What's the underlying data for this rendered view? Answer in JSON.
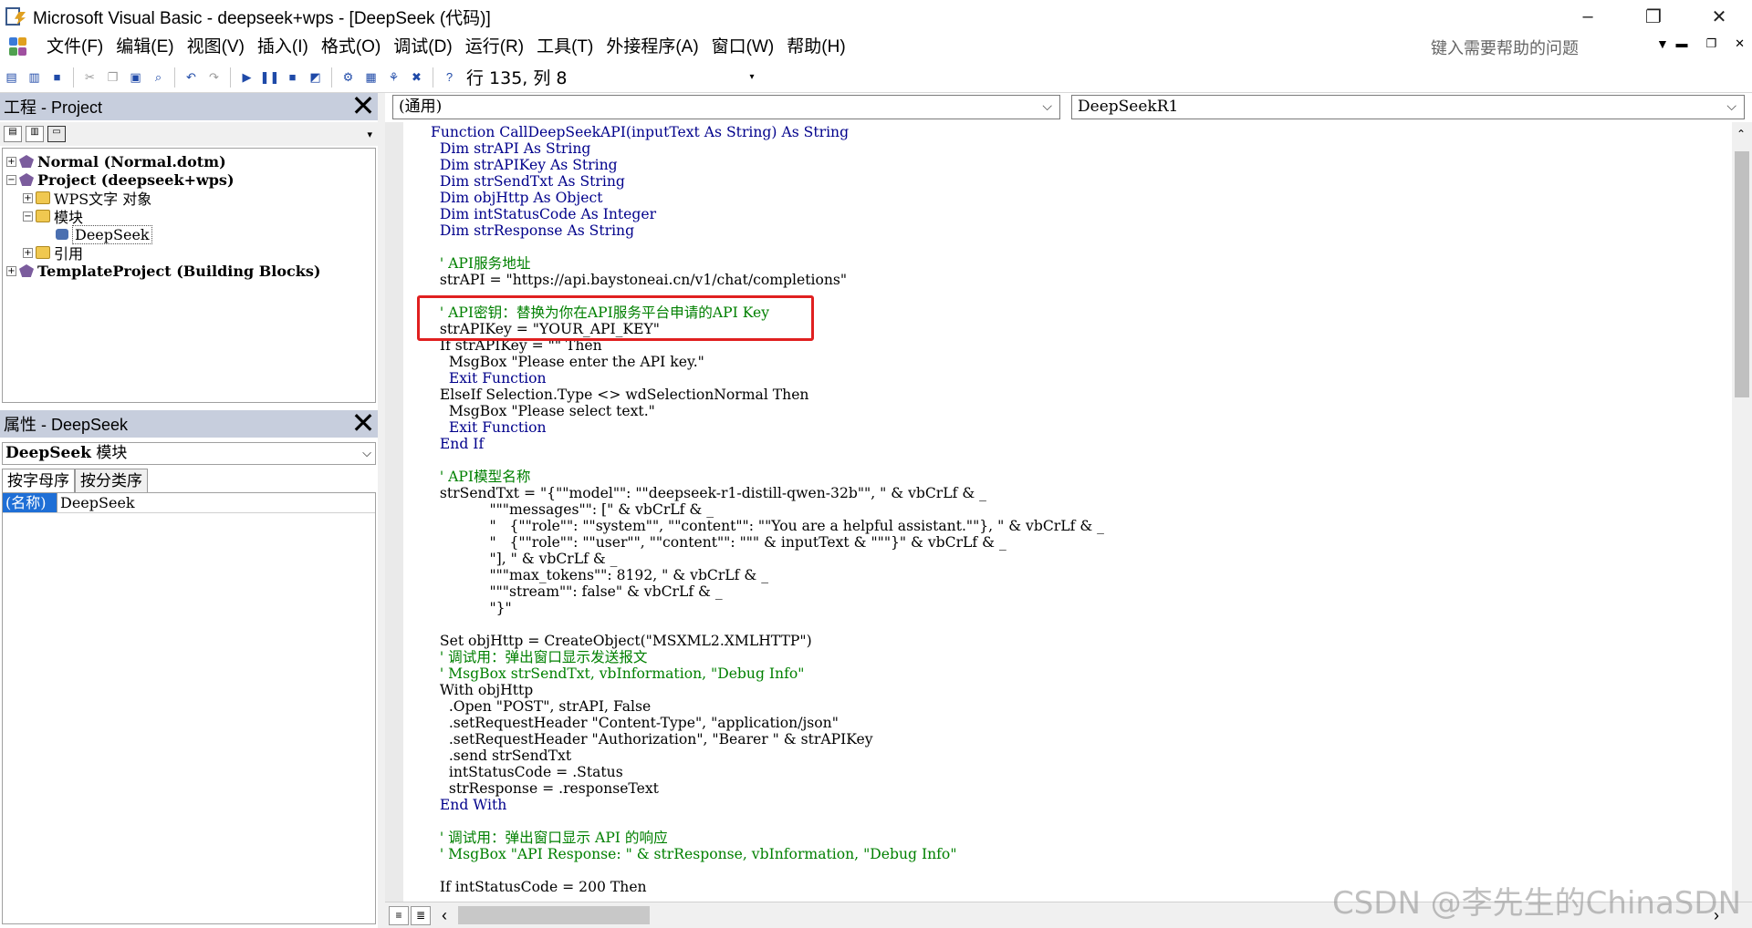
{
  "window": {
    "title": "Microsoft Visual Basic - deepseek+wps - [DeepSeek (代码)]",
    "minimize": "–",
    "restore": "❐",
    "close": "✕"
  },
  "menu": {
    "items": [
      "文件(F)",
      "编辑(E)",
      "视图(V)",
      "插入(I)",
      "格式(O)",
      "调试(D)",
      "运行(R)",
      "工具(T)",
      "外接程序(A)",
      "窗口(W)",
      "帮助(H)"
    ],
    "help_placeholder": "键入需要帮助的问题"
  },
  "toolbar": {
    "position_text": "行 135, 列 8"
  },
  "project_panel": {
    "title": "工程 - Project",
    "tree": [
      {
        "label": "Normal (Normal.dotm)",
        "bold": true
      },
      {
        "label": "Project (deepseek+wps)",
        "bold": true
      },
      {
        "label": "WPS文字 对象"
      },
      {
        "label": "模块"
      },
      {
        "label": "DeepSeek"
      },
      {
        "label": "引用"
      },
      {
        "label": "TemplateProject (Building Blocks)",
        "bold": true
      }
    ]
  },
  "properties_panel": {
    "title": "属性 - DeepSeek",
    "object_combo_bold": "DeepSeek",
    "object_combo_rest": " 模块",
    "tab_alpha": "按字母序",
    "tab_category": "按分类序",
    "rows": [
      {
        "key": "(名称)",
        "value": "DeepSeek"
      }
    ]
  },
  "code_window": {
    "object_combo": "(通用)",
    "proc_combo": "DeepSeekR1",
    "lines": [
      {
        "text": "Function CallDeepSeekAPI(inputText As String) As String",
        "type": "kw"
      },
      {
        "text": "  Dim strAPI As String",
        "type": "kw"
      },
      {
        "text": "  Dim strAPIKey As String",
        "type": "kw"
      },
      {
        "text": "  Dim strSendTxt As String",
        "type": "kw"
      },
      {
        "text": "  Dim objHttp As Object",
        "type": "kw"
      },
      {
        "text": "  Dim intStatusCode As Integer",
        "type": "kw"
      },
      {
        "text": "  Dim strResponse As String",
        "type": "kw"
      },
      {
        "text": "",
        "type": "n"
      },
      {
        "text": "  ' API服务地址",
        "type": "cm"
      },
      {
        "text": "  strAPI = \"https://api.baystoneai.cn/v1/chat/completions\"",
        "type": "n"
      },
      {
        "text": "",
        "type": "n"
      },
      {
        "text": "  ' API密钥：替换为你在API服务平台申请的API Key",
        "type": "cm"
      },
      {
        "text": "  strAPIKey = \"YOUR_API_KEY\"",
        "type": "n"
      },
      {
        "text": "  If strAPIKey = \"\" Then",
        "type": "n"
      },
      {
        "text": "    MsgBox \"Please enter the API key.\"",
        "type": "n"
      },
      {
        "text": "    Exit Function",
        "type": "kw"
      },
      {
        "text": "  ElseIf Selection.Type <> wdSelectionNormal Then",
        "type": "n"
      },
      {
        "text": "    MsgBox \"Please select text.\"",
        "type": "n"
      },
      {
        "text": "    Exit Function",
        "type": "kw"
      },
      {
        "text": "  End If",
        "type": "kw"
      },
      {
        "text": "",
        "type": "n"
      },
      {
        "text": "  ' API模型名称",
        "type": "cm"
      },
      {
        "text": "  strSendTxt = \"{\"\"model\"\": \"\"deepseek-r1-distill-qwen-32b\"\", \" & vbCrLf & _",
        "type": "n"
      },
      {
        "text": "             \"\"\"messages\"\": [\" & vbCrLf & _",
        "type": "n"
      },
      {
        "text": "             \"   {\"\"role\"\": \"\"system\"\", \"\"content\"\": \"\"You are a helpful assistant.\"\"}, \" & vbCrLf & _",
        "type": "n"
      },
      {
        "text": "             \"   {\"\"role\"\": \"\"user\"\", \"\"content\"\": \"\"\" & inputText & \"\"\"}\" & vbCrLf & _",
        "type": "n"
      },
      {
        "text": "             \"], \" & vbCrLf & _",
        "type": "n"
      },
      {
        "text": "             \"\"\"max_tokens\"\": 8192, \" & vbCrLf & _",
        "type": "n"
      },
      {
        "text": "             \"\"\"stream\"\": false\" & vbCrLf & _",
        "type": "n"
      },
      {
        "text": "             \"}\"",
        "type": "n"
      },
      {
        "text": "",
        "type": "n"
      },
      {
        "text": "  Set objHttp = CreateObject(\"MSXML2.XMLHTTP\")",
        "type": "n"
      },
      {
        "text": "  ' 调试用：弹出窗口显示发送报文",
        "type": "cm"
      },
      {
        "text": "  ' MsgBox strSendTxt, vbInformation, \"Debug Info\"",
        "type": "cm"
      },
      {
        "text": "  With objHttp",
        "type": "n"
      },
      {
        "text": "    .Open \"POST\", strAPI, False",
        "type": "n"
      },
      {
        "text": "    .setRequestHeader \"Content-Type\", \"application/json\"",
        "type": "n"
      },
      {
        "text": "    .setRequestHeader \"Authorization\", \"Bearer \" & strAPIKey",
        "type": "n"
      },
      {
        "text": "    .send strSendTxt",
        "type": "n"
      },
      {
        "text": "    intStatusCode = .Status",
        "type": "n"
      },
      {
        "text": "    strResponse = .responseText",
        "type": "n"
      },
      {
        "text": "  End With",
        "type": "kw"
      },
      {
        "text": "",
        "type": "n"
      },
      {
        "text": "  ' 调试用：弹出窗口显示 API 的响应",
        "type": "cm"
      },
      {
        "text": "  ' MsgBox \"API Response: \" & strResponse, vbInformation, \"Debug Info\"",
        "type": "cm"
      },
      {
        "text": "",
        "type": "n"
      },
      {
        "text": "  If intStatusCode = 200 Then",
        "type": "n"
      }
    ]
  },
  "watermark": "CSDN @李先生的ChinaSDN"
}
